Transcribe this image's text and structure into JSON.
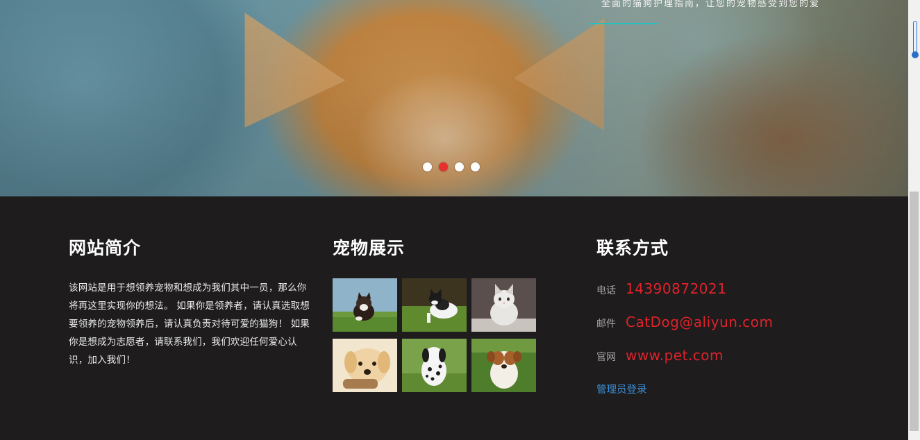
{
  "hero": {
    "caption": "全面的猫狗护理指南，让您的宠物感受到您的爱",
    "carousel": {
      "slide_count": 4,
      "active_index": 1
    }
  },
  "about": {
    "title": "网站简介",
    "text": "该网站是用于想领养宠物和想成为我们其中一员，那么你将再这里实现你的想法。 如果你是领养者，请认真选取想要领养的宠物领养后，请认真负责对待可爱的猫狗！ 如果你是想成为志愿者，请联系我们，我们欢迎任何爱心认识，加入我们！"
  },
  "gallery": {
    "title": "宠物展示",
    "images": [
      {
        "name": "kitten-on-grass-photo"
      },
      {
        "name": "black-white-kitten-photo"
      },
      {
        "name": "white-kitten-photo"
      },
      {
        "name": "golden-puppy-photo"
      },
      {
        "name": "dalmatian-puppy-photo"
      },
      {
        "name": "brown-white-puppy-photo"
      }
    ]
  },
  "contact": {
    "title": "联系方式",
    "phone_label": "电话",
    "phone": "14390872021",
    "email_label": "邮件",
    "email": "CatDog@aliyun.com",
    "site_label": "官网",
    "site": "www.pet.com",
    "admin_login": "管理员登录"
  },
  "colors": {
    "footer_bg": "#1e1c1d",
    "accent_red": "#e0232b",
    "link_blue": "#3a8fd8",
    "underline_teal": "#23c2c2"
  }
}
